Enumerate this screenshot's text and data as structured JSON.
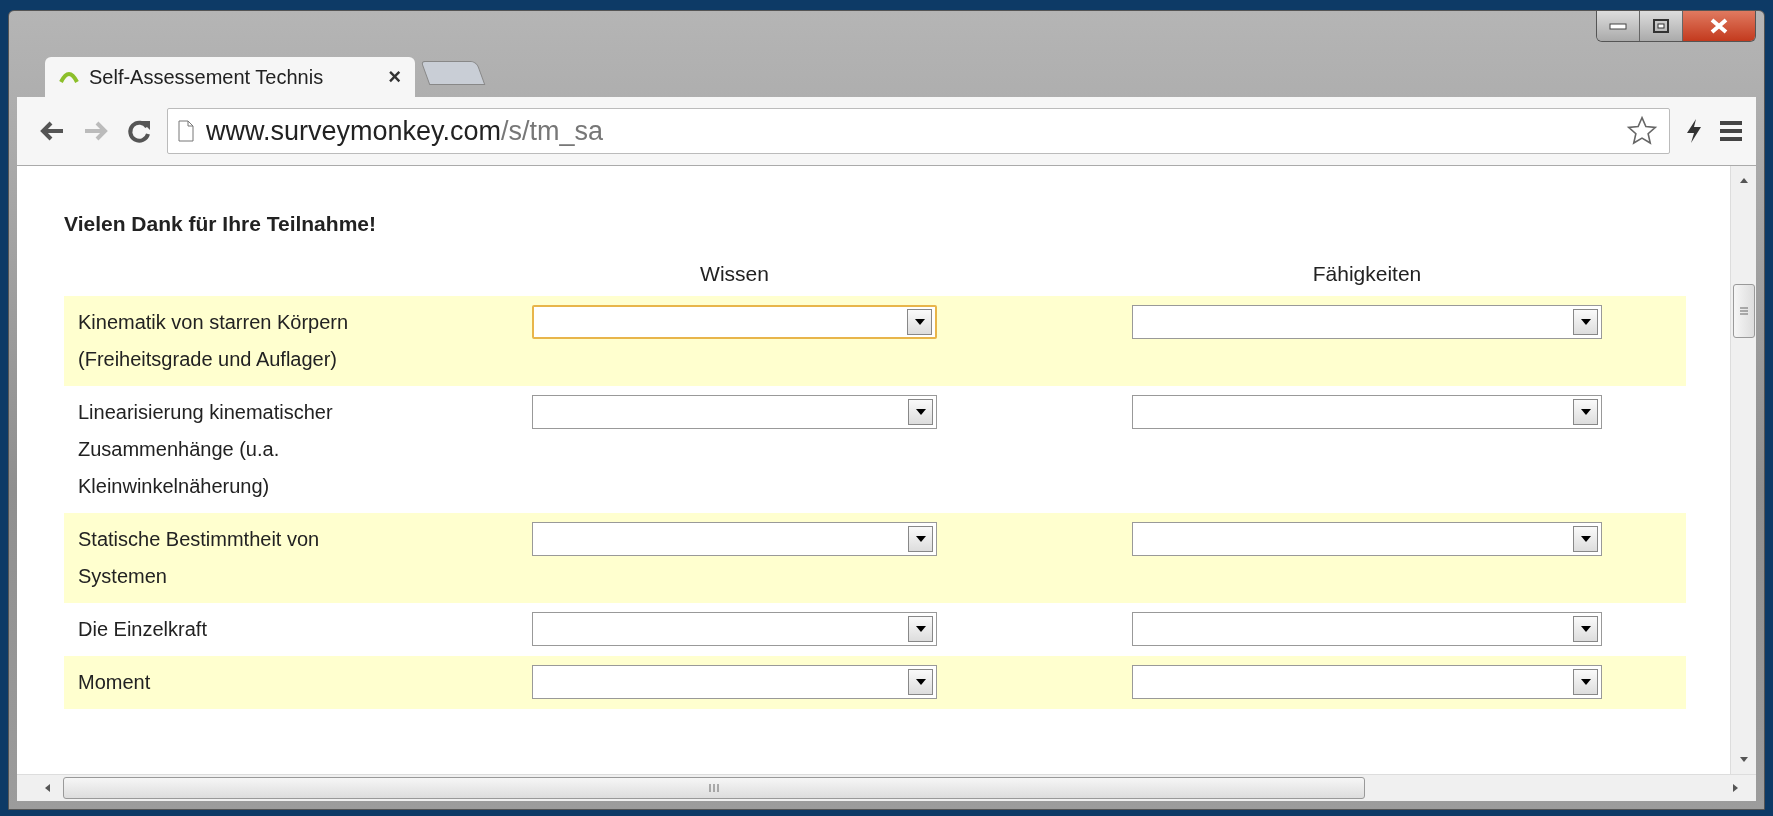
{
  "window": {
    "tabs": [
      {
        "title": "Self-Assessement Technis",
        "close": "×",
        "selected": true
      },
      {
        "selected": false
      }
    ]
  },
  "address_bar": {
    "host": "www.surveymonkey.com",
    "path": "/s/tm_sa"
  },
  "survey": {
    "heading": "Vielen Dank für Ihre Teilnahme!",
    "columns": [
      "Wissen",
      "Fähigkeiten"
    ],
    "rows": [
      {
        "label": "Kinematik von starren Körpern (Freiheitsgrade und Auflager)",
        "highlighted": true,
        "selects": [
          {
            "focused": true
          },
          {
            "focused": false
          }
        ]
      },
      {
        "label": "Linearisierung kinematischer Zusammenhänge (u.a. Kleinwinkelnäherung)",
        "highlighted": false,
        "selects": [
          {
            "focused": false
          },
          {
            "focused": false
          }
        ]
      },
      {
        "label": "Statische Bestimmtheit von Systemen",
        "highlighted": true,
        "selects": [
          {
            "focused": false
          },
          {
            "focused": false
          }
        ]
      },
      {
        "label": "Die Einzelkraft",
        "highlighted": false,
        "selects": [
          {
            "focused": false
          },
          {
            "focused": false
          }
        ]
      },
      {
        "label": "Moment",
        "highlighted": true,
        "selects": [
          {
            "focused": false
          },
          {
            "focused": false
          }
        ]
      }
    ]
  }
}
